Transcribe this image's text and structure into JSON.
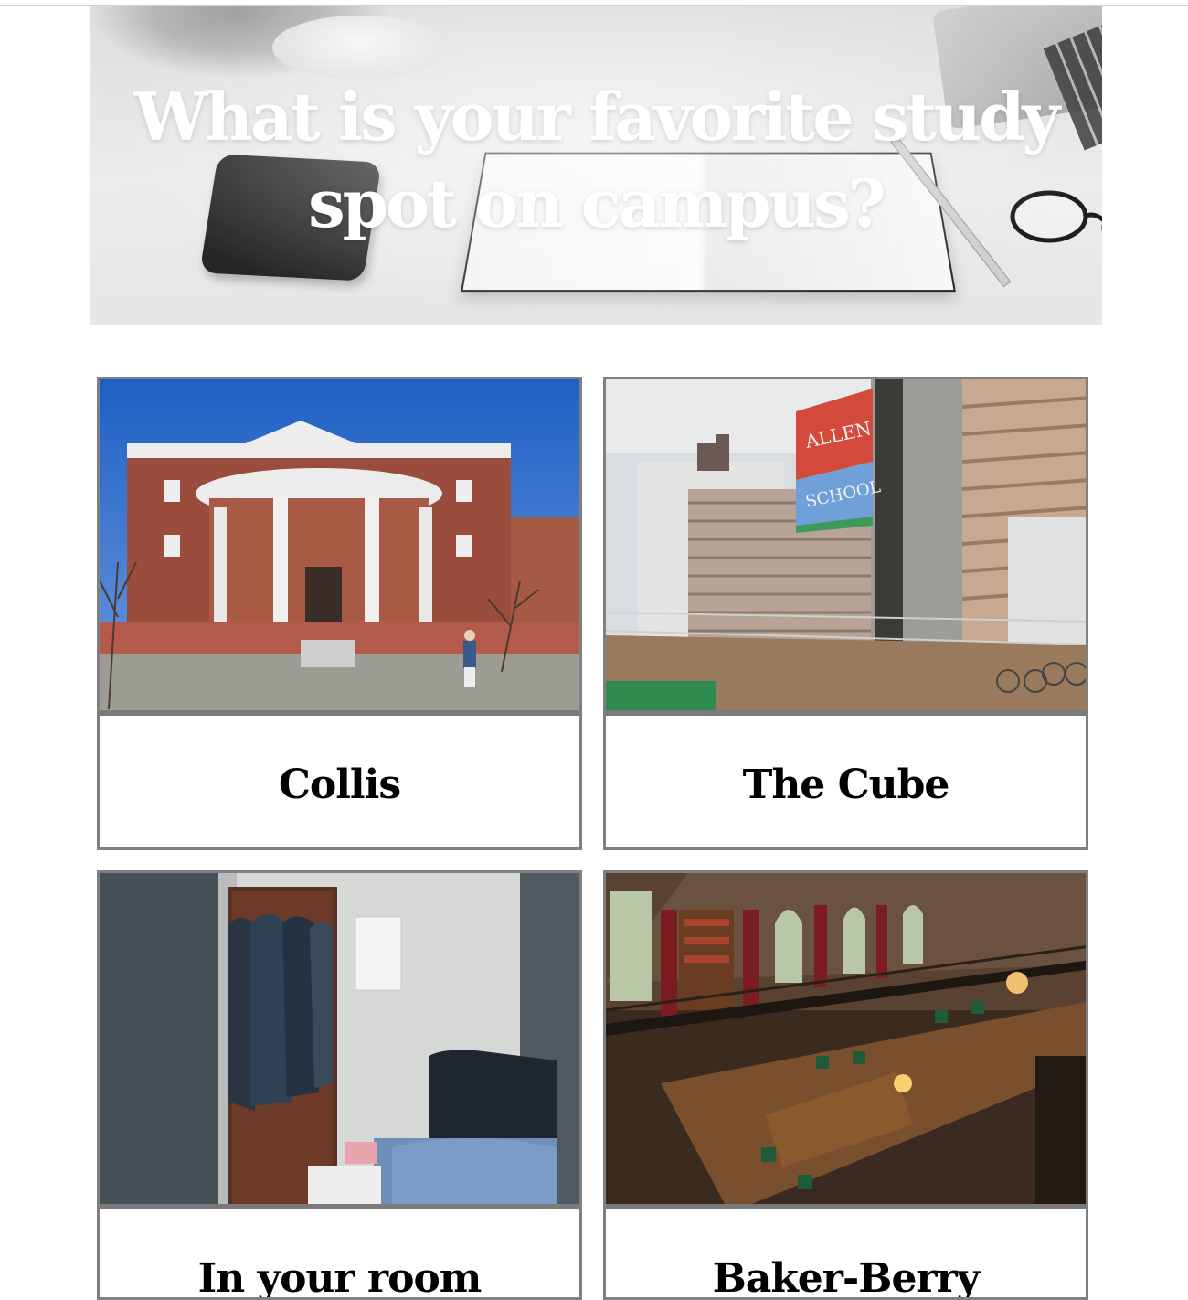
{
  "hero": {
    "title": "What is your favorite study spot on campus?"
  },
  "cards": [
    {
      "label": "Collis"
    },
    {
      "label": "The Cube"
    },
    {
      "label": "In your room"
    },
    {
      "label": "Baker-Berry"
    }
  ]
}
